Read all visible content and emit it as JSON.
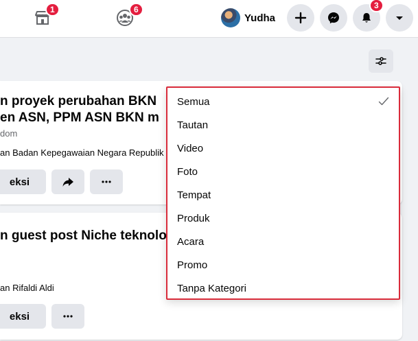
{
  "topbar": {
    "marketplace_badge": "1",
    "groups_badge": "6",
    "profile_name": "Yudha",
    "notifications_badge": "3"
  },
  "cards": [
    {
      "title_line1": "n proyek perubahan BKN",
      "title_line2": "en ASN, PPM ASN BKN m",
      "subtitle": "dom",
      "body": "an Badan Kepegawaian Negara Republik I",
      "react_label": "eksi"
    },
    {
      "title_line1": "n guest post Niche teknolo",
      "body": "an Rifaldi Aldi",
      "react_label": "eksi"
    }
  ],
  "filter_menu": {
    "items": [
      {
        "label": "Semua",
        "selected": true
      },
      {
        "label": "Tautan",
        "selected": false
      },
      {
        "label": "Video",
        "selected": false
      },
      {
        "label": "Foto",
        "selected": false
      },
      {
        "label": "Tempat",
        "selected": false
      },
      {
        "label": "Produk",
        "selected": false
      },
      {
        "label": "Acara",
        "selected": false
      },
      {
        "label": "Promo",
        "selected": false
      },
      {
        "label": "Tanpa Kategori",
        "selected": false
      }
    ]
  },
  "colors": {
    "badge": "#e41e3f",
    "highlight_border": "#d92b3a",
    "button_bg": "#e4e6eb"
  }
}
